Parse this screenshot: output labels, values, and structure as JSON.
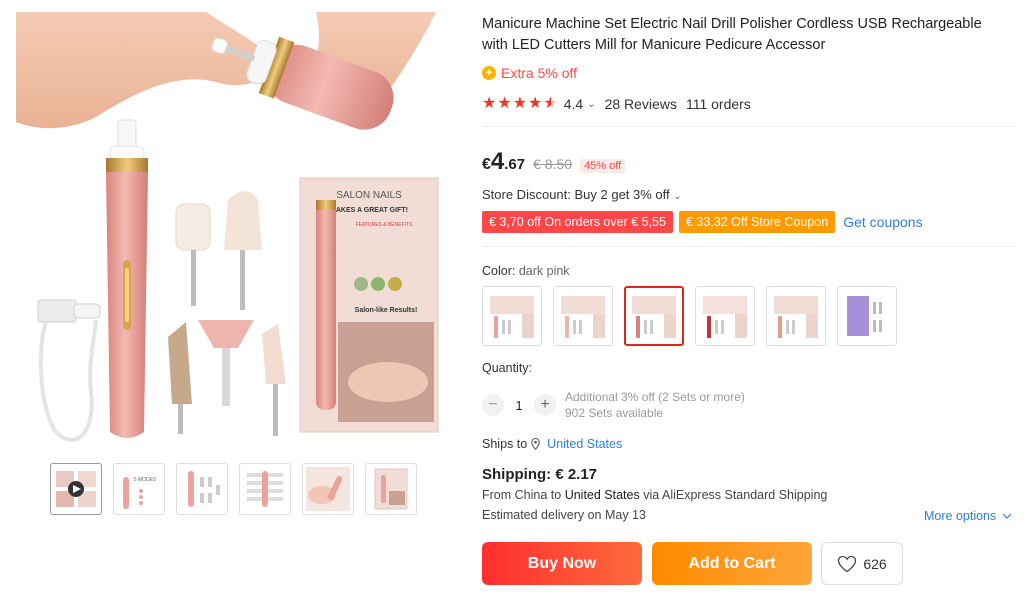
{
  "product": {
    "title": "Manicure Machine Set Electric Nail Drill Polisher Cordless USB Rechargeable with LED Cutters Mill for Manicure Pedicure Accessor",
    "extra_discount": "Extra 5% off",
    "coin_glyph": "+",
    "rating": "4.4",
    "rating_stars": 4.5,
    "reviews": "28 Reviews",
    "orders": "111 orders"
  },
  "gallery": {
    "box_heading": "SALON NAILS",
    "box_sub": "MAKES A GREAT GIFT!",
    "box_features": "FEATURES & BENEFITS",
    "box_tagline": "Salon-like Results!",
    "thumb_label": "5 MODES"
  },
  "price": {
    "currency": "€",
    "integer": "4",
    "decimal": ".67",
    "original": "€ 8.50",
    "discount_badge": "45% off"
  },
  "store": {
    "discount_text": "Store Discount: Buy 2 get 3% off",
    "coupon_red": "€ 3,70 off On orders over € 5,55",
    "coupon_orange": "€ 33,32 Off Store Coupon",
    "get_coupons": "Get coupons"
  },
  "color": {
    "label": "Color:",
    "selected": "dark pink",
    "selected_index": 2,
    "swatch_count": 6
  },
  "quantity": {
    "label": "Quantity:",
    "value": "1",
    "minus": "−",
    "plus": "+",
    "note1": "Additional 3% off (2 Sets or more)",
    "note2": "902 Sets available"
  },
  "shipping": {
    "ships_to_label": "Ships to",
    "country": "United States",
    "title": "Shipping: € 2.17",
    "from_text": "From China to",
    "dest": "United States",
    "via_text": "via AliExpress Standard Shipping",
    "delivery": "Estimated delivery on May 13",
    "more_options": "More options"
  },
  "actions": {
    "buy_now": "Buy Now",
    "add_to_cart": "Add to Cart",
    "wishlist_count": "626"
  },
  "colors": {
    "accent_red": "#ff4747",
    "accent_orange": "#ff9a00",
    "link_blue": "#2e7fd8",
    "product_pink": "#e8a4a0"
  }
}
